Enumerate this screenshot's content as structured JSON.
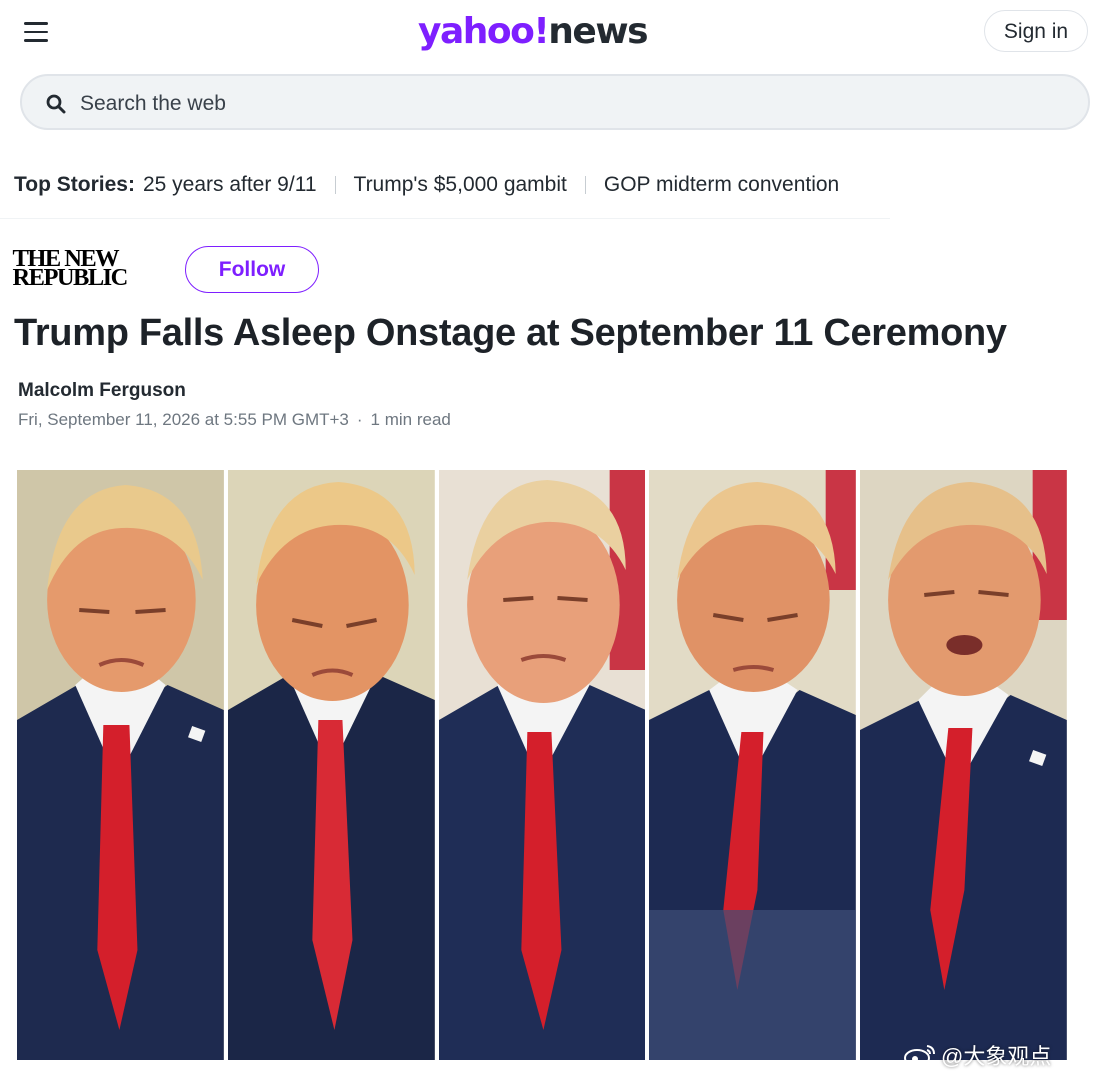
{
  "header": {
    "logo_text_1": "yahoo!",
    "logo_text_2": "news",
    "sign_in_label": "Sign in",
    "menu_icon": "hamburger-menu-icon"
  },
  "search": {
    "placeholder": "Search the web",
    "icon": "search-icon"
  },
  "top_stories": {
    "label": "Top Stories:",
    "items": [
      "25 years after 9/11",
      "Trump's $5,000 gambit",
      "GOP midterm convention"
    ]
  },
  "article": {
    "publisher_line_1": "THE NEW",
    "publisher_line_2": "REPUBLIC",
    "follow_label": "Follow",
    "title": "Trump Falls Asleep Onstage at September 11  Ceremony",
    "author": "Malcolm Ferguson",
    "date": "Fri, September 11, 2026 at 5:55 PM GMT+3",
    "read_time": "1 min read",
    "photo_count": 5
  },
  "watermark": {
    "text": "@大象观点"
  },
  "colors": {
    "brand_purple": "#7e1fff",
    "text_dark": "#1d2228",
    "meta_gray": "#6e7780",
    "search_bg": "#f0f3f5"
  }
}
